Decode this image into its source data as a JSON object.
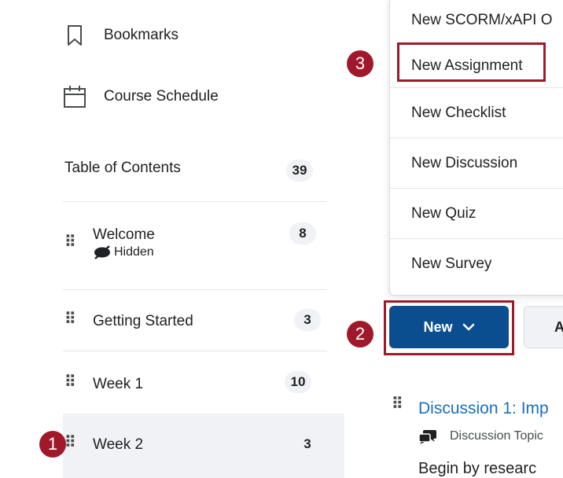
{
  "sidebar": {
    "bookmarks_label": "Bookmarks",
    "schedule_label": "Course Schedule",
    "toc": {
      "label": "Table of Contents",
      "count": "39"
    },
    "modules": [
      {
        "label": "Welcome",
        "count": "8",
        "status": "Hidden"
      },
      {
        "label": "Getting Started",
        "count": "3"
      },
      {
        "label": "Week 1",
        "count": "10"
      },
      {
        "label": "Week 2",
        "count": "3",
        "selected": true
      }
    ]
  },
  "callouts": {
    "one": "1",
    "two": "2",
    "three": "3"
  },
  "menu": {
    "items": [
      "New SCORM/xAPI O",
      "New Assignment",
      "New Checklist",
      "New Discussion",
      "New Quiz",
      "New Survey"
    ]
  },
  "toolbar": {
    "new_label": "New",
    "other_label": "A"
  },
  "content": {
    "item_title": "Discussion 1: Imp",
    "item_type": "Discussion Topic",
    "item_body": "Begin by researc"
  },
  "colors": {
    "accent": "#a0192a",
    "primary": "#0b4e8f",
    "link": "#1a6fc0"
  }
}
